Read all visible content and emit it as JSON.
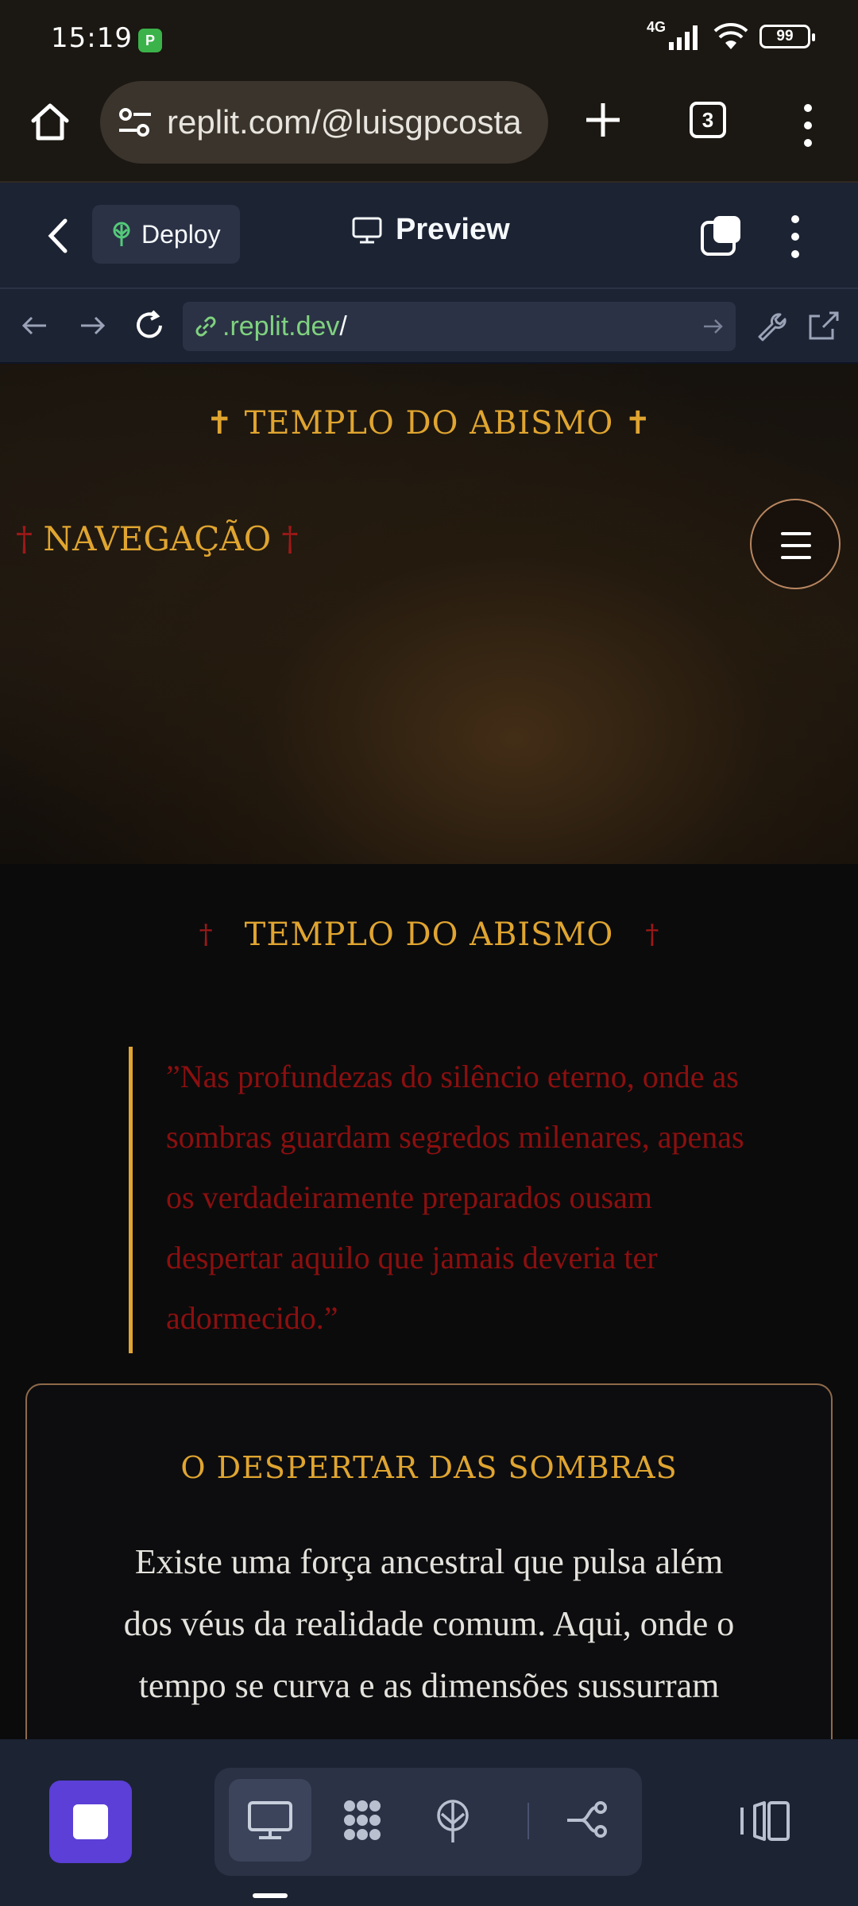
{
  "status_bar": {
    "time": "15:19",
    "network": "4G",
    "battery": "99"
  },
  "browser": {
    "url": "replit.com/@luisgpcosta",
    "tab_count": "3"
  },
  "replit_header": {
    "deploy_label": "Deploy",
    "preview_label": "Preview"
  },
  "replit_urlbar": {
    "domain": ".replit.dev",
    "path": "/"
  },
  "site": {
    "hero_title": "✝ TEMPLO DO ABISMO ✝",
    "nav_cross_left": "†",
    "nav_label": "NAVEGAÇÃO",
    "nav_cross_right": "†",
    "section_cross_left": "†",
    "section_title": "TEMPLO DO ABISMO",
    "section_cross_right": "†",
    "quote": "”Nas profundezas do silêncio eterno, onde as sombras guardam segredos milenares, apenas os verdadeiramente preparados ousam despertar aquilo que jamais deveria ter adormecido.”",
    "card_title": "O DESPERTAR DAS SOMBRAS",
    "card_body": "Existe uma força ancestral que pulsa além dos véus da realidade comum. Aqui, onde o tempo se curva e as dimensões sussurram"
  },
  "colors": {
    "gold": "#e0a530",
    "blood_red": "#8c0f0f",
    "replit_bg": "#1c2333",
    "run_purple": "#5b3fd6"
  }
}
